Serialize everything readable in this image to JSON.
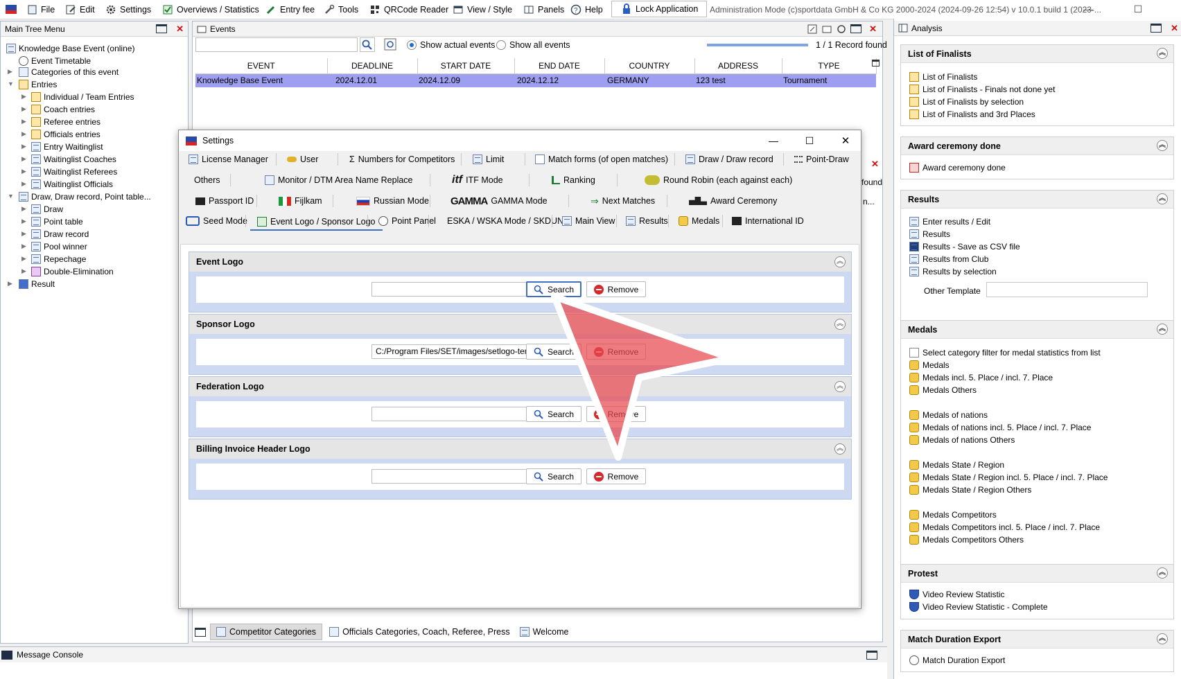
{
  "menubar": {
    "items": [
      "File",
      "Edit",
      "Settings",
      "Overviews / Statistics",
      "Entry fee",
      "Tools",
      "QRCode Reader",
      "View / Style",
      "Panels",
      "Help"
    ],
    "lock_label": "Lock Application",
    "title": "Administration Mode (c)sportdata GmbH & Co KG 2000-2024 (2024-09-26 12:54)  v 10.0.1 build 1 (2023-..."
  },
  "tree": {
    "title": "Main Tree Menu",
    "nodes": [
      "Knowledge Base Event (online)",
      "Event Timetable",
      "Categories of this event",
      "Entries",
      "Individual / Team Entries",
      "Coach entries",
      "Referee entries",
      "Officials entries",
      "Entry Waitinglist",
      "Waitinglist Coaches",
      "Waitinglist Referees",
      "Waitinglist Officials",
      "Draw, Draw record, Point table...",
      "Draw",
      "Point table",
      "Draw record",
      "Pool winner",
      "Repechage",
      "Double-Elimination",
      "Result"
    ]
  },
  "events": {
    "title": "Events",
    "radio_actual": "Show actual events",
    "radio_all": "Show all events",
    "record_count": "1 / 1 Record found",
    "columns": [
      "EVENT",
      "DEADLINE",
      "START DATE",
      "END DATE",
      "COUNTRY",
      "ADDRESS",
      "TYPE"
    ],
    "row": [
      "Knowledge Base Event",
      "2024.12.01",
      "2024.12.09",
      "2024.12.12",
      "GERMANY",
      "123 test",
      "Tournament"
    ],
    "found_partial": "found",
    "n_partial": "n..."
  },
  "settings": {
    "title": "Settings",
    "tabs_row1": [
      "License Manager",
      "User",
      "Numbers for Competitors",
      "Limit",
      "Match forms (of open matches)",
      "Draw / Draw record",
      "Point-Draw"
    ],
    "tabs_row2": [
      "Others",
      "Monitor / DTM Area Name Replace",
      "ITF Mode",
      "Ranking",
      "Round Robin (each against each)"
    ],
    "tabs_row3": [
      "Passport ID",
      "Fijlkam",
      "Russian Mode",
      "GAMMA Mode",
      "Next Matches",
      "Award Ceremony"
    ],
    "tabs_row4": [
      "Seed Mode",
      "Event Logo / Sponsor Logo",
      "Point Panel",
      "ESKA / WSKA Mode / SKDUN",
      "Main View",
      "Results",
      "Medals",
      "International ID"
    ],
    "itf_logo": "itf",
    "gamma_logo": "GAMMA",
    "sections": [
      {
        "title": "Event Logo",
        "value": "",
        "search": "Search",
        "remove": "Remove"
      },
      {
        "title": "Sponsor Logo",
        "value": "C:/Program Files/SET/images/setlogo-ten",
        "search": "Search",
        "remove": "Remove"
      },
      {
        "title": "Federation Logo",
        "value": "",
        "search": "Search",
        "remove": "Remove"
      },
      {
        "title": "Billing Invoice Header Logo",
        "value": "",
        "search": "Search",
        "remove": "Remove"
      }
    ]
  },
  "bottom_tabs": [
    "Competitor Categories",
    "Officials Categories, Coach, Referee, Press",
    "Welcome"
  ],
  "console": {
    "title": "Message Console"
  },
  "analysis": {
    "title": "Analysis",
    "finalists": {
      "title": "List of Finalists",
      "items": [
        "List of Finalists",
        "List of Finalists - Finals not done yet",
        "List of Finalists by selection",
        "List of Finalists and 3rd Places"
      ]
    },
    "award": {
      "title": "Award ceremony done",
      "items": [
        "Award ceremony done"
      ]
    },
    "results": {
      "title": "Results",
      "items": [
        "Enter results / Edit",
        "Results",
        "Results - Save as CSV file",
        "Results from Club",
        "Results by selection"
      ],
      "other_template": "Other Template"
    },
    "medals": {
      "title": "Medals",
      "filter": "Select category filter for medal statistics from list",
      "items": [
        "Medals",
        "Medals incl. 5. Place / incl. 7. Place",
        "Medals Others",
        "Medals of nations",
        "Medals of nations incl. 5. Place / incl. 7. Place",
        "Medals of nations Others",
        "Medals State / Region",
        "Medals State / Region incl. 5. Place / incl. 7. Place",
        "Medals State / Region Others",
        "Medals Competitors",
        "Medals Competitors incl. 5. Place / incl. 7. Place",
        "Medals Competitors Others"
      ]
    },
    "protest": {
      "title": "Protest",
      "items": [
        "Video Review Statistic",
        "Video Review Statistic - Complete"
      ]
    },
    "duration": {
      "title": "Match Duration Export",
      "items": [
        "Match Duration Export"
      ]
    }
  },
  "colors": {
    "highlight_row": "#9f9ff2",
    "section_bg": "#cdd9f2",
    "remove_red": "#d9282b",
    "pointer": "#e8484d"
  }
}
